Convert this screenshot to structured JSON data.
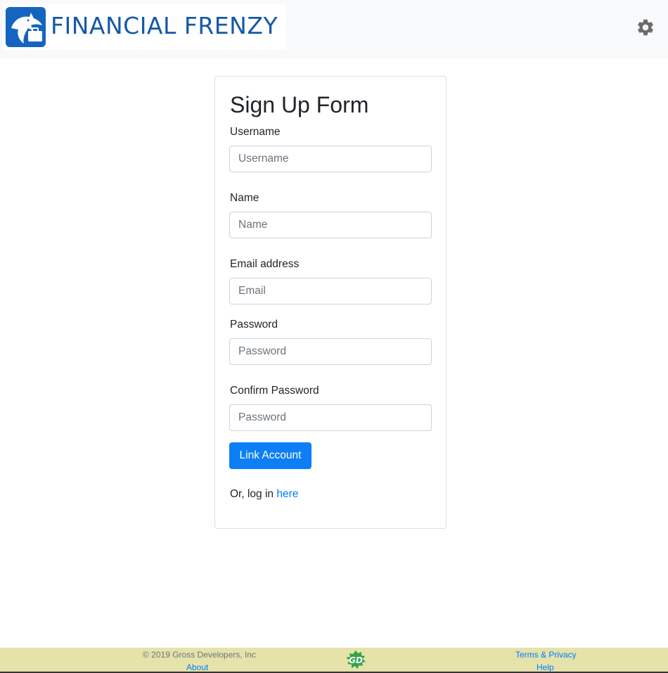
{
  "header": {
    "brand_name": "FINANCIAL FRENZY",
    "settings_icon": "gear-icon"
  },
  "form": {
    "title": "Sign Up Form",
    "fields": [
      {
        "label": "Username",
        "placeholder": "Username",
        "value": ""
      },
      {
        "label": "Name",
        "placeholder": "Name",
        "value": ""
      },
      {
        "label": "Email address",
        "placeholder": "Email",
        "value": ""
      },
      {
        "label": "Password",
        "placeholder": "Password",
        "value": ""
      },
      {
        "label": "Confirm Password",
        "placeholder": "Password",
        "value": ""
      }
    ],
    "submit_label": "Link Account",
    "login_prefix": "Or, log in ",
    "login_link": "here"
  },
  "footer": {
    "copyright": "© 2019 Gross Developers, Inc",
    "about": "About",
    "logo_text": "GD",
    "terms": "Terms & Privacy",
    "help": "Help"
  },
  "colors": {
    "primary": "#0d7ff6",
    "brand_blue": "#1565c0",
    "footer_bg": "#e5e3aa",
    "navbar_bg": "#f8f9fa"
  }
}
